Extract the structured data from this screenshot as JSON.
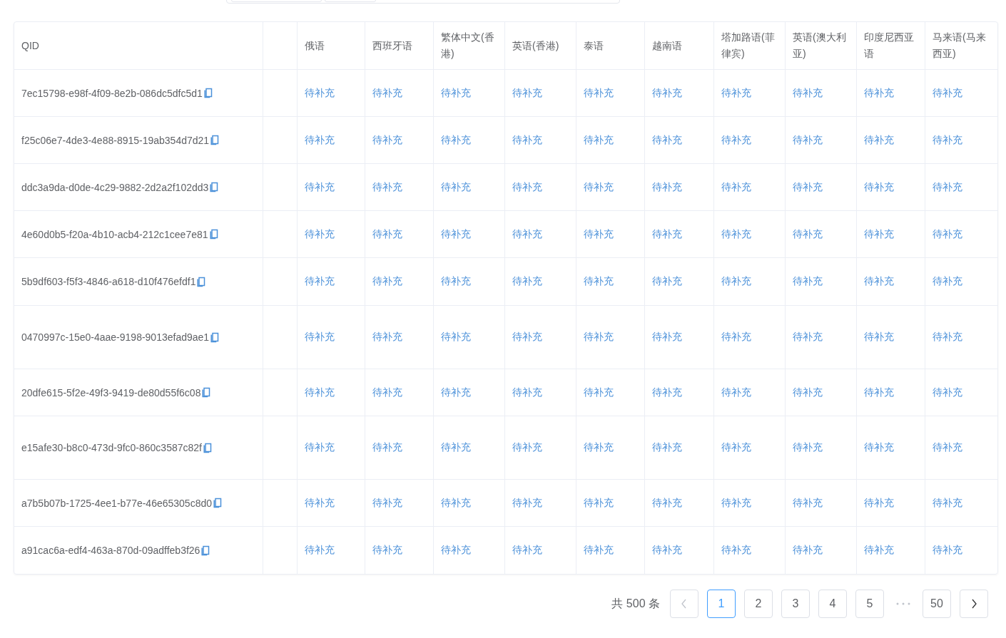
{
  "table": {
    "columns": [
      "QID",
      "俄语",
      "西班牙语",
      "繁体中文(香港)",
      "英语(香港)",
      "泰语",
      "越南语",
      "塔加路语(菲律宾)",
      "英语(澳大利亚)",
      "印度尼西亚语",
      "马来语(马来西亚)"
    ],
    "rows": [
      {
        "qid": "7ec15798-e98f-4f09-8e2b-086dc5dfc5d1",
        "values": [
          "待补充",
          "待补充",
          "待补充",
          "待补充",
          "待补充",
          "待补充",
          "待补充",
          "待补充",
          "待补充",
          "待补充"
        ]
      },
      {
        "qid": "f25c06e7-4de3-4e88-8915-19ab354d7d21",
        "values": [
          "待补充",
          "待补充",
          "待补充",
          "待补充",
          "待补充",
          "待补充",
          "待补充",
          "待补充",
          "待补充",
          "待补充"
        ]
      },
      {
        "qid": "ddc3a9da-d0de-4c29-9882-2d2a2f102dd3",
        "values": [
          "待补充",
          "待补充",
          "待补充",
          "待补充",
          "待补充",
          "待补充",
          "待补充",
          "待补充",
          "待补充",
          "待补充"
        ]
      },
      {
        "qid": "4e60d0b5-f20a-4b10-acb4-212c1cee7e81",
        "values": [
          "待补充",
          "待补充",
          "待补充",
          "待补充",
          "待补充",
          "待补充",
          "待补充",
          "待补充",
          "待补充",
          "待补充"
        ]
      },
      {
        "qid": "5b9df603-f5f3-4846-a618-d10f476efdf1",
        "values": [
          "待补充",
          "待补充",
          "待补充",
          "待补充",
          "待补充",
          "待补充",
          "待补充",
          "待补充",
          "待补充",
          "待补充"
        ]
      },
      {
        "qid": "0470997c-15e0-4aae-9198-9013efad9ae1",
        "values": [
          "待补充",
          "待补充",
          "待补充",
          "待补充",
          "待补充",
          "待补充",
          "待补充",
          "待补充",
          "待补充",
          "待补充"
        ]
      },
      {
        "qid": "20dfe615-5f2e-49f3-9419-de80d55f6c08",
        "values": [
          "待补充",
          "待补充",
          "待补充",
          "待补充",
          "待补充",
          "待补充",
          "待补充",
          "待补充",
          "待补充",
          "待补充"
        ]
      },
      {
        "qid": "e15afe30-b8c0-473d-9fc0-860c3587c82f",
        "values": [
          "待补充",
          "待补充",
          "待补充",
          "待补充",
          "待补充",
          "待补充",
          "待补充",
          "待补充",
          "待补充",
          "待补充"
        ]
      },
      {
        "qid": "a7b5b07b-1725-4ee1-b77e-46e65305c8d0",
        "values": [
          "待补充",
          "待补充",
          "待补充",
          "待补充",
          "待补充",
          "待补充",
          "待补充",
          "待补充",
          "待补充",
          "待补充"
        ]
      },
      {
        "qid": "a91cac6a-edf4-463a-870d-09adffeb3f26",
        "values": [
          "待补充",
          "待补充",
          "待补充",
          "待补充",
          "待补充",
          "待补充",
          "待补充",
          "待补充",
          "待补充",
          "待补充"
        ]
      }
    ]
  },
  "pagination": {
    "total": "共 500 条",
    "prev": {
      "disabled": true
    },
    "next": {
      "disabled": false
    },
    "pages": [
      {
        "label": "1",
        "selected": true
      },
      {
        "label": "2",
        "selected": false
      },
      {
        "label": "3",
        "selected": false
      },
      {
        "label": "4",
        "selected": false
      },
      {
        "label": "5",
        "selected": false
      },
      {
        "label": "50",
        "selected": false,
        "kind": "after-gap"
      }
    ]
  }
}
